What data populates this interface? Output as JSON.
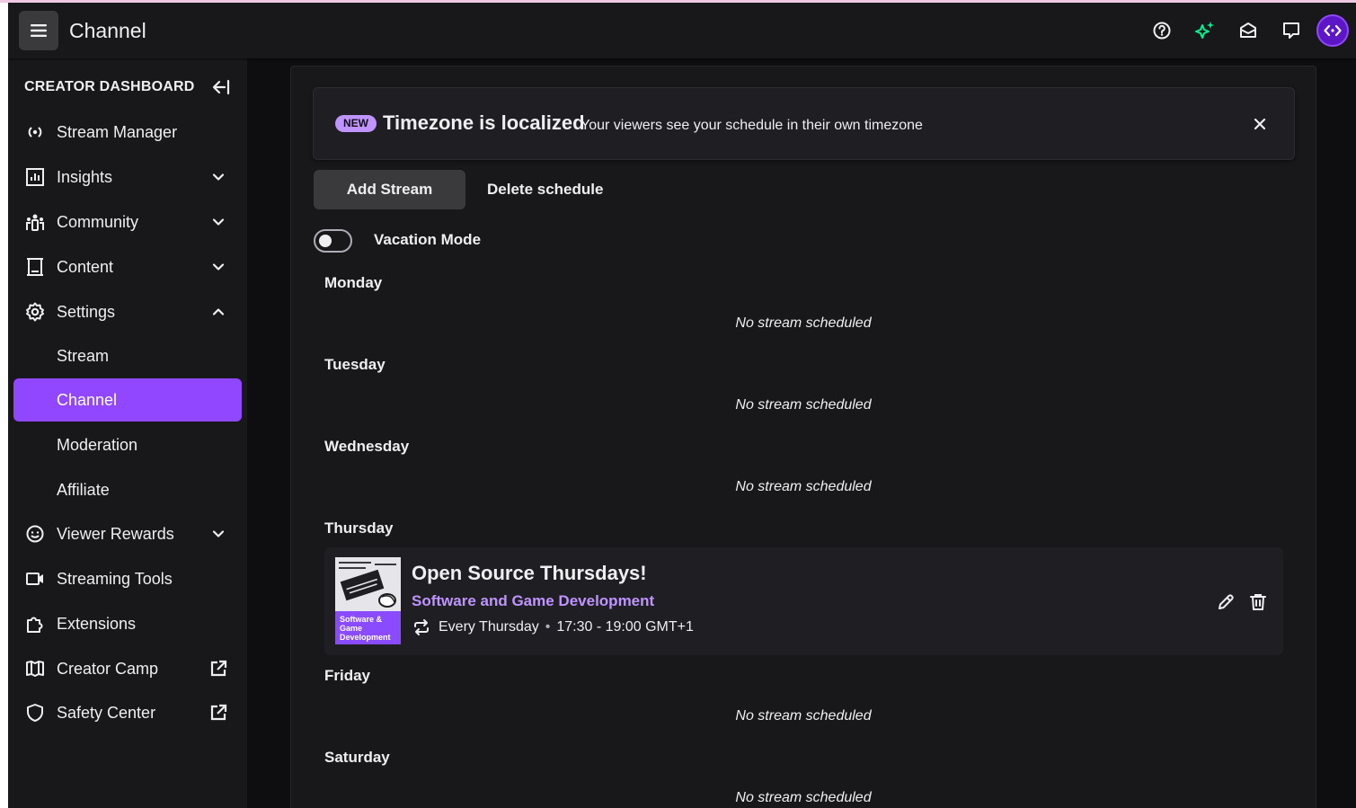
{
  "header": {
    "title": "Channel",
    "icons": [
      "menu-icon",
      "help-icon",
      "sparkle-icon",
      "inbox-icon",
      "whispers-icon",
      "avatar"
    ],
    "accent_color": "#9147ff",
    "sparkle_color": "#00f593"
  },
  "sidebar": {
    "heading": "CREATOR DASHBOARD",
    "items": [
      {
        "label": "Stream Manager",
        "icon": "broadcast-icon"
      },
      {
        "label": "Insights",
        "icon": "insights-icon",
        "expandable": true
      },
      {
        "label": "Community",
        "icon": "community-icon",
        "expandable": true
      },
      {
        "label": "Content",
        "icon": "content-icon",
        "expandable": true
      },
      {
        "label": "Settings",
        "icon": "settings-icon",
        "expanded": true
      },
      {
        "label": "Stream",
        "sub": true
      },
      {
        "label": "Channel",
        "sub": true,
        "active": true
      },
      {
        "label": "Moderation",
        "sub": true
      },
      {
        "label": "Affiliate",
        "sub": true
      },
      {
        "label": "Viewer Rewards",
        "icon": "rewards-icon",
        "expandable": true
      },
      {
        "label": "Streaming Tools",
        "icon": "camera-icon"
      },
      {
        "label": "Extensions",
        "icon": "extensions-icon"
      },
      {
        "label": "Creator Camp",
        "icon": "book-icon",
        "external": true
      },
      {
        "label": "Safety Center",
        "icon": "shield-icon",
        "external": true
      }
    ]
  },
  "banner": {
    "badge": "NEW",
    "title": "Timezone is localized",
    "text": "Your viewers see your schedule in their own timezone"
  },
  "actions": {
    "add_stream": "Add Stream",
    "delete_schedule": "Delete schedule"
  },
  "vacation": {
    "label": "Vacation Mode",
    "enabled": false
  },
  "schedule": {
    "empty_text": "No stream scheduled",
    "days": [
      "Monday",
      "Tuesday",
      "Wednesday",
      "Thursday",
      "Friday",
      "Saturday"
    ]
  },
  "stream": {
    "title": "Open Source Thursdays!",
    "category": "Software and Game Development",
    "thumbnail_text": "Software & Game Development",
    "recurrence": "Every Thursday",
    "separator": "•",
    "time": "17:30 - 19:00 GMT+1"
  }
}
